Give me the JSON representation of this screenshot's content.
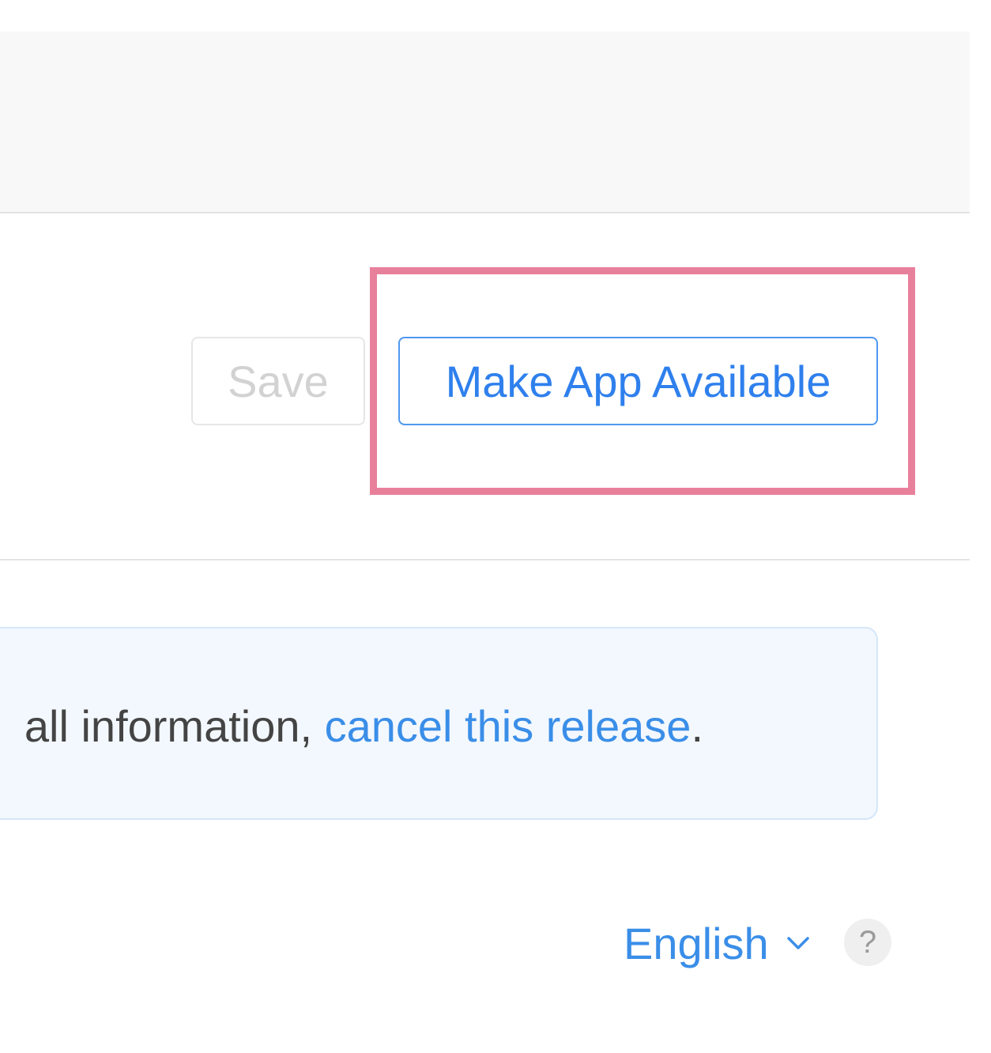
{
  "toolbar": {
    "save_label": "Save",
    "primary_label": "Make App Available"
  },
  "notice": {
    "text_prefix": "all information, ",
    "link_text": "cancel this release",
    "text_suffix": "."
  },
  "footer": {
    "language": "English",
    "help_glyph": "?"
  },
  "icons": {
    "language_chevron": "chevron-down-icon",
    "help": "help-icon"
  },
  "colors": {
    "accent": "#2f80ed",
    "highlight": "#e8809c",
    "notice_background": "#f3f8fe"
  }
}
